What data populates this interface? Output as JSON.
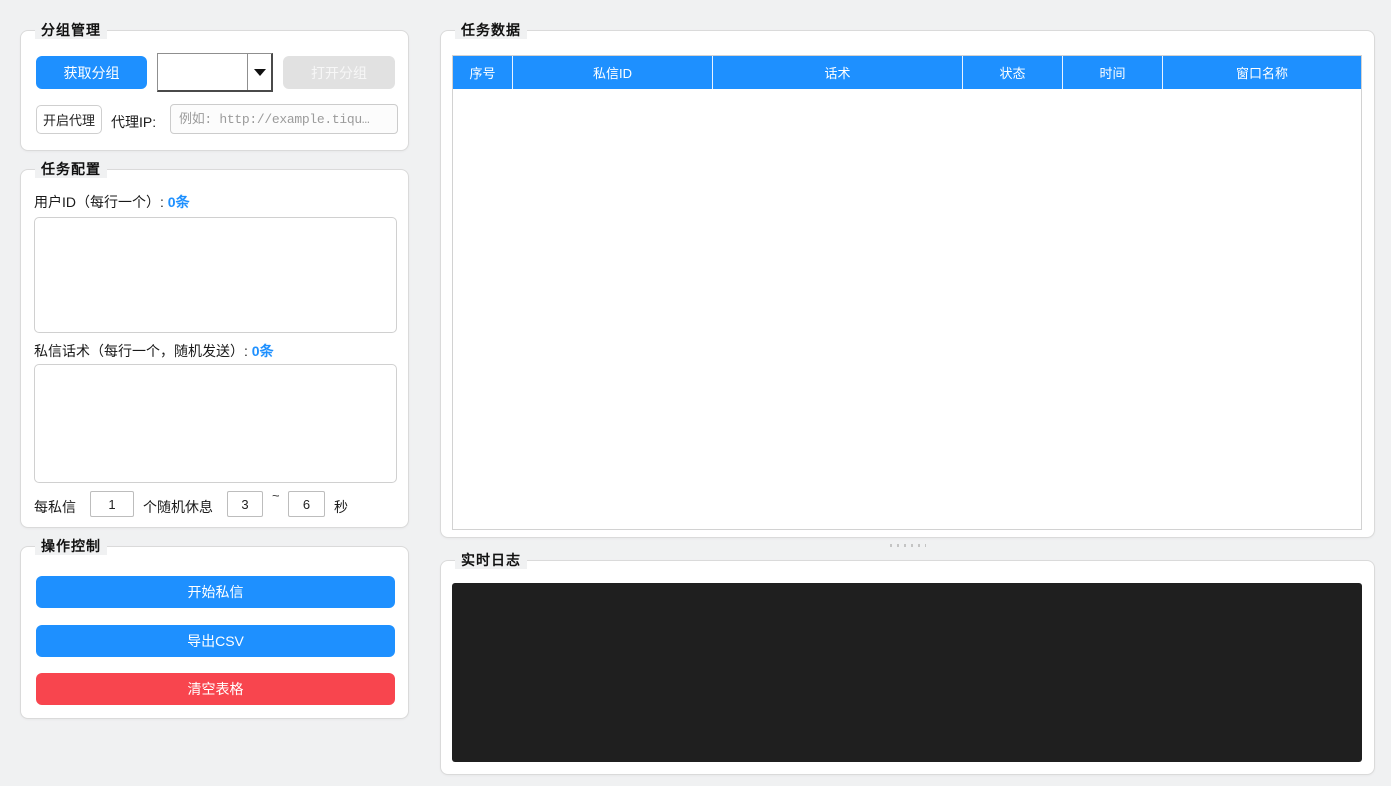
{
  "panels": {
    "group_management": {
      "title": "分组管理",
      "get_groups_button": "获取分组",
      "group_select_value": "",
      "open_group_button": "打开分组",
      "enable_proxy_button": "开启代理",
      "proxy_ip_label": "代理IP:",
      "proxy_ip_placeholder": "例如: http://example.tiqu…",
      "proxy_ip_value": ""
    },
    "task_config": {
      "title": "任务配置",
      "user_id_label": "用户ID（每行一个）:",
      "user_id_count": "0条",
      "user_id_value": "",
      "message_label": "私信话术（每行一个，随机发送）:",
      "message_count": "0条",
      "message_value": "",
      "per_message_label": "每私信",
      "per_message_value": "1",
      "rest_label": "个随机休息",
      "rest_min_value": "3",
      "tilde": "~",
      "rest_max_value": "6",
      "seconds_label": "秒"
    },
    "operation_control": {
      "title": "操作控制",
      "start_button": "开始私信",
      "export_button": "导出CSV",
      "clear_button": "清空表格"
    },
    "task_data": {
      "title": "任务数据",
      "columns": [
        "序号",
        "私信ID",
        "话术",
        "状态",
        "时间",
        "窗口名称"
      ],
      "rows": []
    },
    "log": {
      "title": "实时日志",
      "content": ""
    }
  },
  "colors": {
    "accent_blue": "#1e90ff",
    "danger_red": "#f8454e",
    "log_background": "#1f1f1f"
  }
}
